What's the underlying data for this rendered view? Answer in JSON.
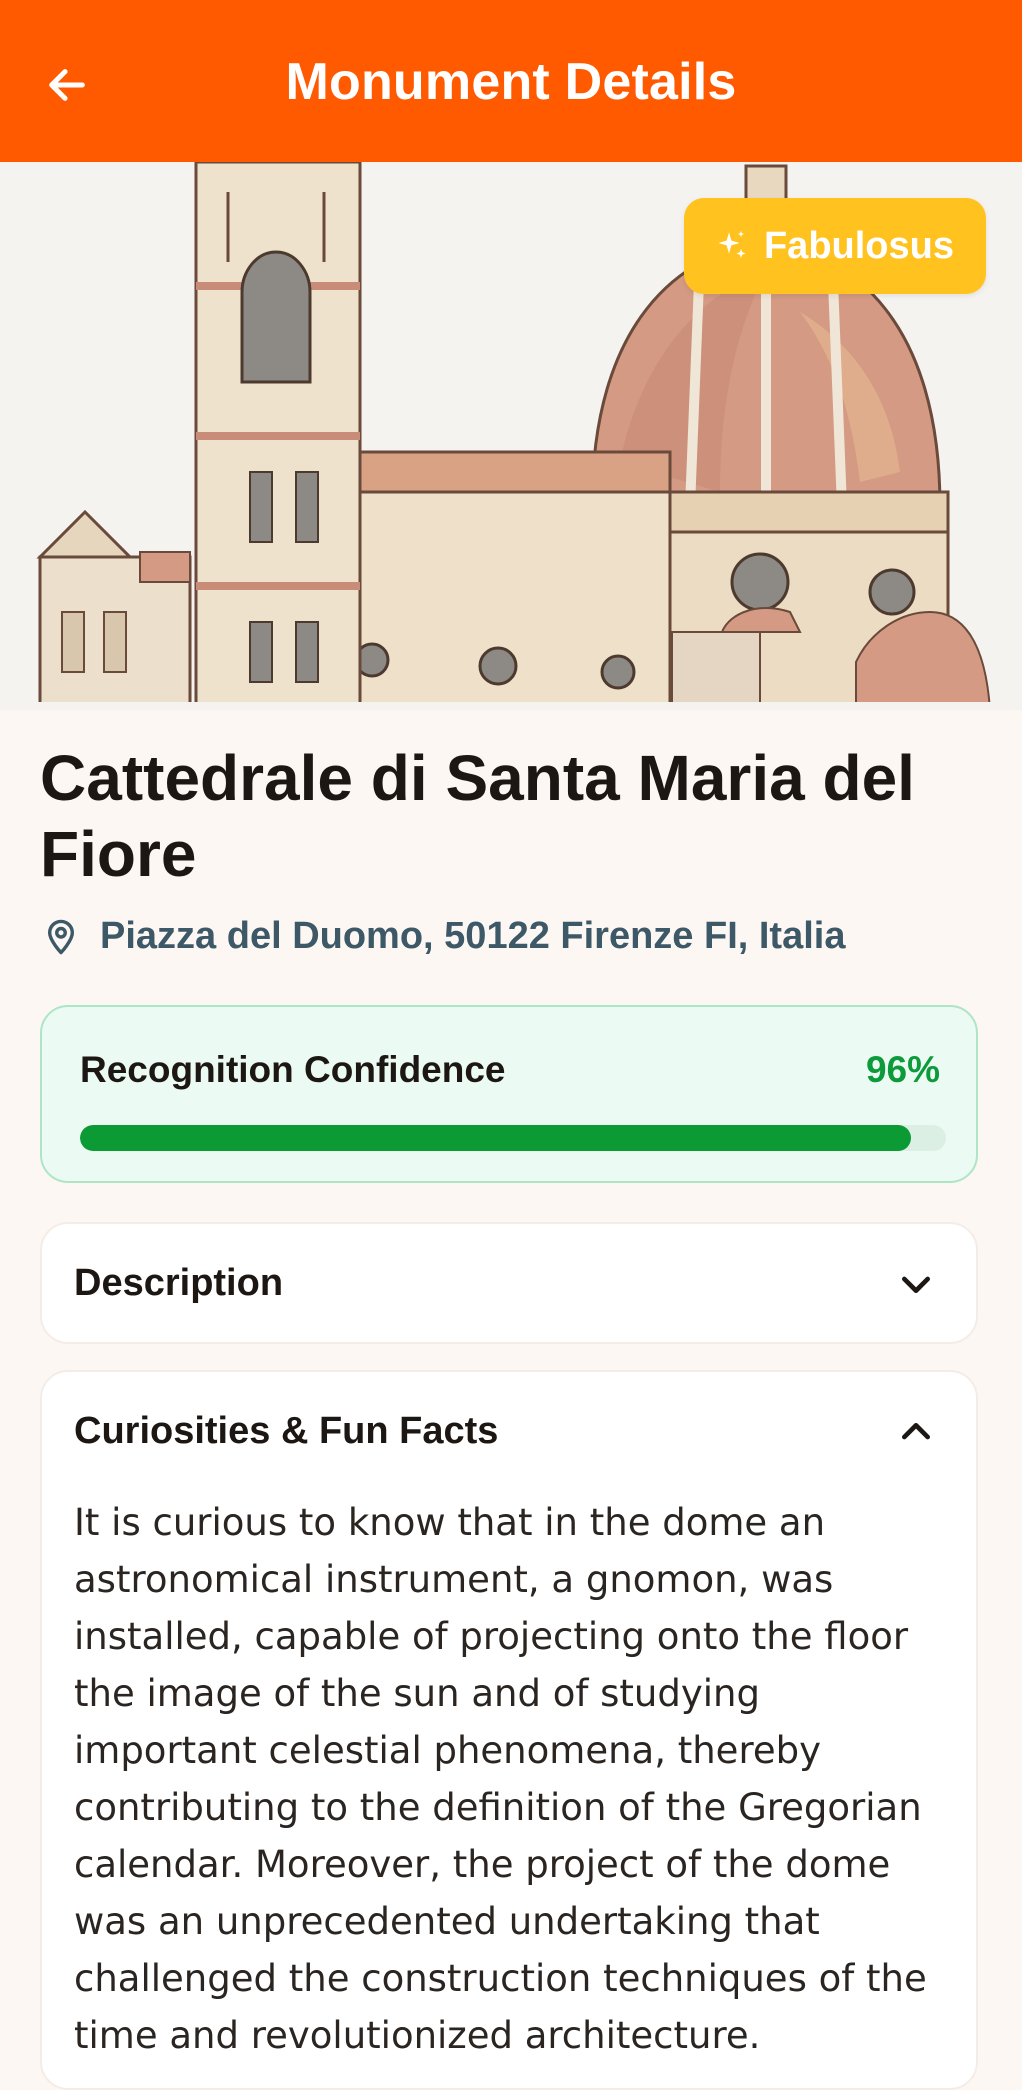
{
  "app_bar": {
    "title": "Monument Details",
    "back_icon": "arrow-left-icon",
    "background": "#ff5a00"
  },
  "hero": {
    "badge_label": "Fabulosus",
    "badge_icon": "sparkles-icon",
    "badge_color": "#ffc21f"
  },
  "monument": {
    "name": "Cattedrale di Santa Maria del Fiore",
    "address": "Piazza del Duomo, 50122 Firenze FI, Italia",
    "location_icon": "map-pin-icon"
  },
  "confidence": {
    "label": "Recognition Confidence",
    "value_text": "96%",
    "value": 0.96,
    "color": "#0b9a33"
  },
  "sections": {
    "description": {
      "title": "Description",
      "icon": "chevron-down-icon",
      "expanded": false
    },
    "curiosities": {
      "title": "Curiosities & Fun Facts",
      "icon": "chevron-up-icon",
      "expanded": true,
      "body": "It is curious to know that in the dome an astronomical instrument, a gnomon, was installed, capable of projecting onto the floor the image of the sun and of studying important celestial phenomena, thereby contributing to the definition of the Gregorian calendar. Moreover, the project of the dome was an unprecedented undertaking that challenged the construction techniques of the time and revolutionized architecture."
    }
  }
}
